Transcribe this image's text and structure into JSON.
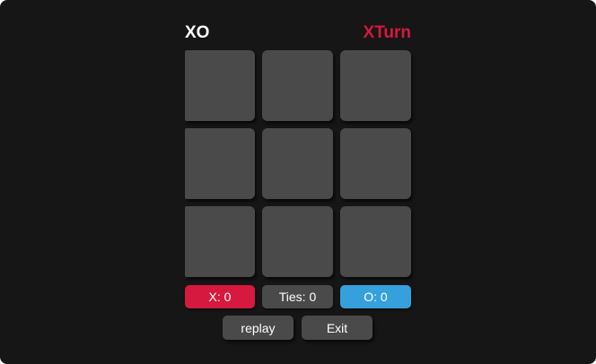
{
  "header": {
    "title": "XO",
    "turn_label": "XTurn"
  },
  "board": {
    "cells": [
      "",
      "",
      "",
      "",
      "",
      "",
      "",
      "",
      ""
    ]
  },
  "scores": {
    "x_label": "X: 0",
    "ties_label": "Ties: 0",
    "o_label": "O: 0"
  },
  "actions": {
    "replay_label": "replay",
    "exit_label": "Exit"
  },
  "colors": {
    "background": "#161616",
    "cell": "#4a4a4a",
    "x_accent": "#d6193f",
    "o_accent": "#36a0dc"
  }
}
